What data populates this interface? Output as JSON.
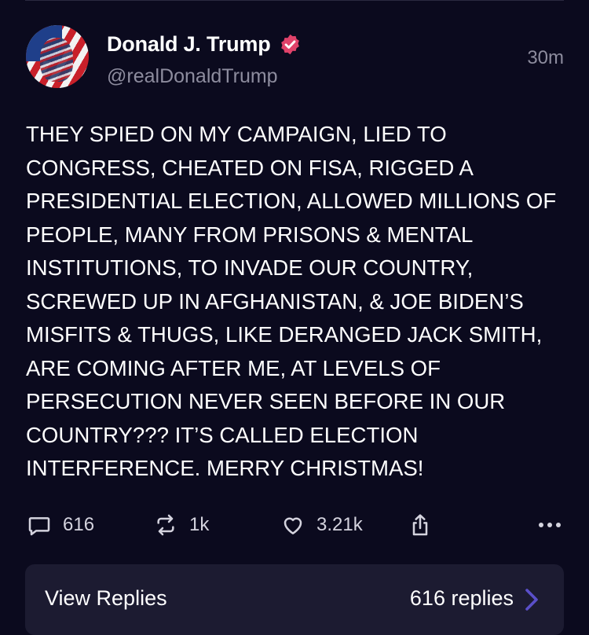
{
  "post": {
    "author_name": "Donald J. Trump",
    "handle": "@realDonaldTrump",
    "timestamp": "30m",
    "text": "THEY SPIED ON MY CAMPAIGN, LIED TO CONGRESS, CHEATED ON FISA, RIGGED A PRESIDENTIAL ELECTION, ALLOWED MILLIONS OF PEOPLE, MANY FROM PRISONS & MENTAL INSTITUTIONS, TO INVADE OUR COUNTRY, SCREWED UP IN AFGHANISTAN, & JOE BIDEN’S MISFITS & THUGS, LIKE DERANGED JACK SMITH, ARE COMING AFTER ME, AT LEVELS OF PERSECUTION NEVER SEEN BEFORE IN OUR COUNTRY??? IT’S CALLED ELECTION INTERFERENCE. MERRY CHRISTMAS!"
  },
  "actions": {
    "replies_count": "616",
    "retruths_count": "1k",
    "likes_count": "3.21k"
  },
  "replies_bar": {
    "label": "View Replies",
    "count_label": "616 replies"
  },
  "colors": {
    "background": "#0b0a1e",
    "verified_badge": "#e0426a",
    "muted_text": "#8d8c9e",
    "chevron": "#5a4fc9"
  },
  "icons": [
    "verified-badge-icon",
    "comment-icon",
    "retruth-icon",
    "heart-icon",
    "share-icon",
    "more-icon",
    "chevron-right-icon"
  ]
}
